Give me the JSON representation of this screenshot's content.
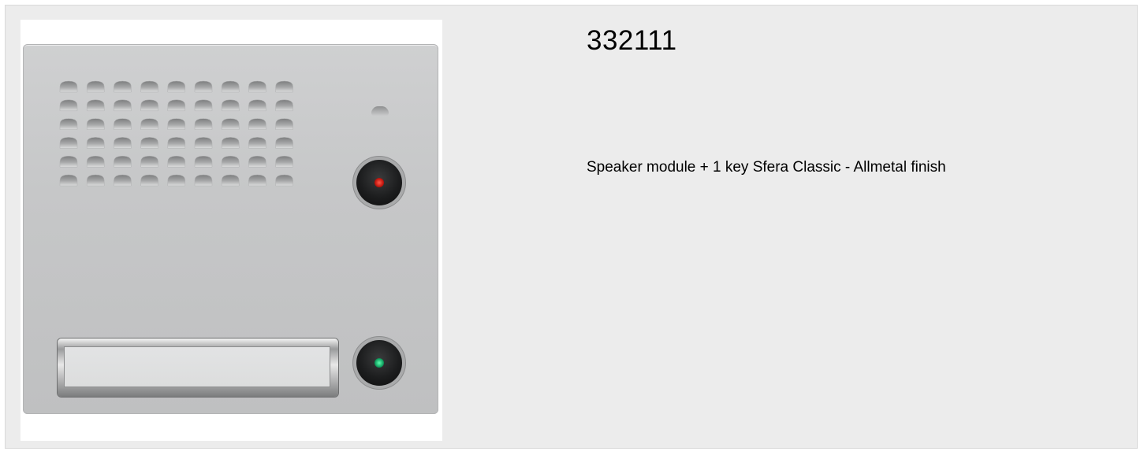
{
  "product": {
    "code": "332111",
    "description": "Speaker module + 1 key Sfera Classic - Allmetal finish",
    "image_alt": "Speaker module with one call key and name plate, Allmetal finish"
  },
  "icons": {
    "status_led": "red-led-icon",
    "call_button_led": "green-led-icon"
  },
  "colors": {
    "card_background": "#ececec",
    "panel_metal": "#c6c7c8",
    "led_red": "#c0160e",
    "led_green": "#12a060"
  }
}
